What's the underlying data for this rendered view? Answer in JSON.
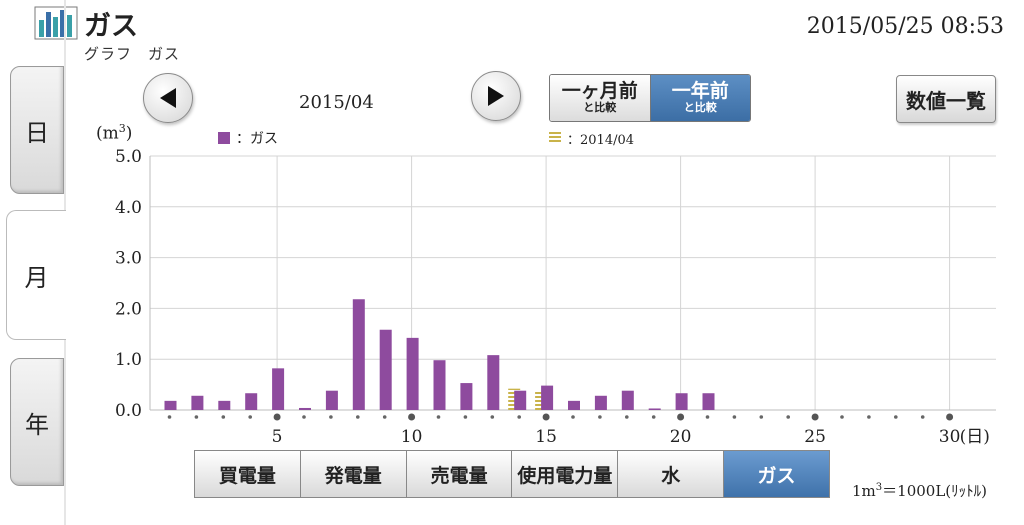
{
  "header": {
    "title": "ガス",
    "subtitle": "グラフ　ガス",
    "datetime": "2015/05/25  08:53",
    "logo_icon": "bar-chart-icon"
  },
  "side_tabs": [
    {
      "label": "日",
      "active": false
    },
    {
      "label": "月",
      "active": true
    },
    {
      "label": "年",
      "active": false
    }
  ],
  "nav": {
    "period": "2015/04",
    "prev_icon": "triangle-left-icon",
    "next_icon": "triangle-right-icon"
  },
  "compare": {
    "month": {
      "big": "一ヶ月前",
      "small": "と比較",
      "active": false
    },
    "year": {
      "big": "一年前",
      "small": "と比較",
      "active": true
    }
  },
  "list_button": "数値一覧",
  "legend": {
    "current": "：ガス",
    "previous": "：2014/04"
  },
  "unit": {
    "base": "(m",
    "sup": "3",
    "close": ")"
  },
  "unit_note": {
    "base": "1m",
    "sup": "3",
    "rest": "＝1000L(ﾘｯﾄﾙ)"
  },
  "colors": {
    "current": "#8e4b9e",
    "previous": "#c9b34a",
    "active_button": "#4a7db5"
  },
  "chart_data": {
    "type": "bar",
    "x_suffix": "(日)",
    "x": [
      1,
      2,
      3,
      4,
      5,
      6,
      7,
      8,
      9,
      10,
      11,
      12,
      13,
      14,
      15,
      16,
      17,
      18,
      19,
      20,
      21,
      22,
      23,
      24,
      25,
      26,
      27,
      28,
      29,
      30
    ],
    "x_tick_labels": [
      "5",
      "10",
      "15",
      "20",
      "25",
      "30"
    ],
    "y_tick_labels": [
      "0.0",
      "1.0",
      "2.0",
      "3.0",
      "4.0",
      "5.0"
    ],
    "ylim": [
      0,
      5.0
    ],
    "grid": true,
    "series": [
      {
        "name": "ガス",
        "values": [
          0.18,
          0.28,
          0.18,
          0.33,
          0.82,
          0.04,
          0.38,
          2.18,
          1.58,
          1.42,
          0.98,
          0.53,
          1.08,
          0.38,
          0.48,
          0.18,
          0.28,
          0.38,
          0.03,
          0.33,
          0.33,
          0,
          0,
          0,
          0,
          0,
          0,
          0,
          0,
          0
        ]
      },
      {
        "name": "2014/04",
        "values": [
          0,
          0,
          0,
          0,
          0,
          0,
          0,
          0,
          0,
          0,
          0,
          0,
          0,
          0.42,
          0.38,
          0,
          0,
          0,
          0,
          0,
          0,
          0,
          0,
          0,
          0,
          0,
          0,
          0,
          0,
          0
        ]
      }
    ]
  },
  "categories": [
    {
      "label": "買電量",
      "active": false
    },
    {
      "label": "発電量",
      "active": false
    },
    {
      "label": "売電量",
      "active": false
    },
    {
      "label": "使用電力量",
      "active": false
    },
    {
      "label": "水",
      "active": false
    },
    {
      "label": "ガス",
      "active": true
    }
  ]
}
